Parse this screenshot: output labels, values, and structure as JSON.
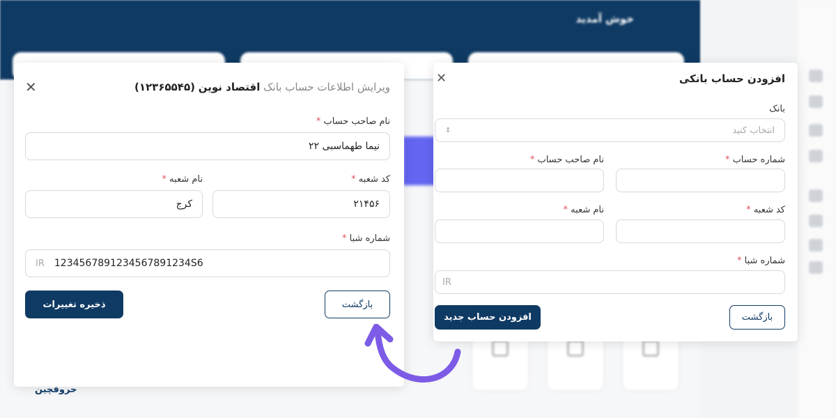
{
  "background": {
    "welcome": "خوش آمدید"
  },
  "edit_modal": {
    "title_prefix": "ویرایش اطلاعات حساب بانک",
    "bank_name": "اقتصاد نوین",
    "account_number": "(۱۲۳۶۵۵۴۵)",
    "holder_label": "نام صاحب حساب",
    "holder_value": "نیما طهماسبی ۲۲",
    "branch_code_label": "کد شعبه",
    "branch_code_value": "۲۱۴۵۶",
    "branch_name_label": "نام شعبه",
    "branch_name_value": "کرج",
    "iban_label": "شماره شبا",
    "iban_prefix": "IR",
    "iban_value": "1234567891234567891234S6",
    "save_label": "ذخیره تغییرات",
    "back_label": "بازگشت"
  },
  "add_modal": {
    "title": "افزودن حساب بانکی",
    "bank_label": "بانک",
    "bank_placeholder": "انتخاب کنید",
    "account_number_label": "شماره حساب",
    "holder_label": "نام صاحب حساب",
    "branch_code_label": "کد شعبه",
    "branch_name_label": "نام شعبه",
    "iban_label": "شماره شبا",
    "iban_prefix": "IR",
    "submit_label": "افزودن حساب جدید",
    "back_label": "بازگشت"
  },
  "required_mark": "*",
  "logo": "حروفچین",
  "colors": {
    "primary": "#0f3a63",
    "required": "#e05260",
    "arrow": "#7c5ce6"
  }
}
